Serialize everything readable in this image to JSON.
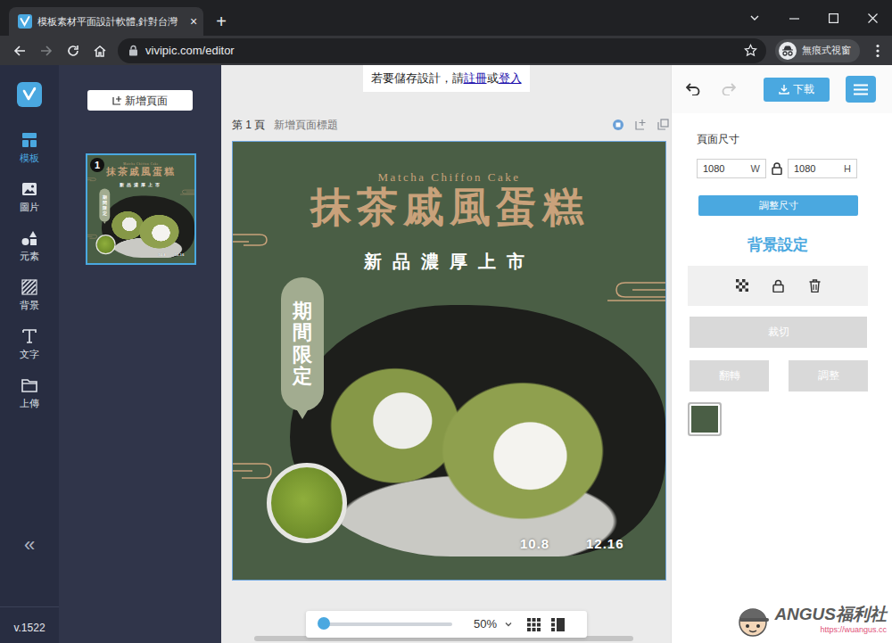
{
  "window": {
    "tabs": [
      {
        "title": "模板素材平面設計軟體,針對台灣",
        "close": "×",
        "selected": true
      }
    ],
    "new_tab": "+",
    "address": "vivipic.com/editor",
    "profile": "無痕式視窗"
  },
  "app": {
    "sidebar": {
      "items": [
        {
          "label": "模板",
          "selected": true
        },
        {
          "label": "圖片",
          "selected": false
        },
        {
          "label": "元素",
          "selected": false
        },
        {
          "label": "背景",
          "selected": false
        },
        {
          "label": "文字",
          "selected": false
        },
        {
          "label": "上傳",
          "selected": false
        }
      ],
      "collapse": "«",
      "version": "v.1522"
    },
    "pages_panel": {
      "add_page": "新增頁面",
      "pages": [
        {
          "number": "1",
          "selected": true
        }
      ]
    },
    "notice": {
      "text": "若要儲存設計，請",
      "register": "註冊",
      "or": "或",
      "login": "登入"
    },
    "page_header": {
      "label": "第 1 頁",
      "title_placeholder": "新增頁面標題"
    },
    "design": {
      "subtitle": "Matcha Chiffon Cake",
      "title": "抹茶戚風蛋糕",
      "tagline": "新品濃厚上市",
      "badge": "期間限定",
      "start_date": "10.8",
      "end_date": "12.16"
    },
    "zoom": {
      "level": 0.03,
      "reading": "50%"
    },
    "right_panel": {
      "undo_disabled": false,
      "redo_disabled": true,
      "download": "下載",
      "page_size": "頁面尺寸",
      "width": "1080",
      "width_unit": "W",
      "height": "1080",
      "height_unit": "H",
      "resize": "調整尺寸",
      "background_heading": "背景設定",
      "crop": {
        "label": "裁切",
        "disabled": true
      },
      "flip": {
        "label": "翻轉",
        "disabled": true
      },
      "adjust": {
        "label": "調整",
        "disabled": true
      },
      "background_color": "#4a5e45"
    }
  },
  "watermark": {
    "brand": "ANGUS福利社",
    "url": "https://wuangus.cc"
  }
}
